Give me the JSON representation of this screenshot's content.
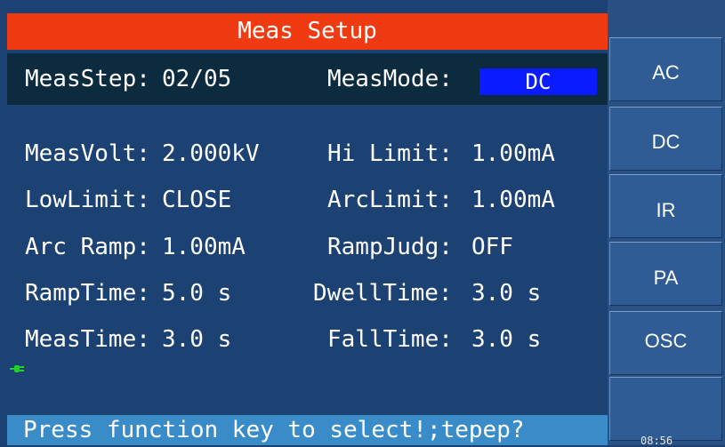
{
  "header": {
    "title": "Meas Setup"
  },
  "step_bar": {
    "meas_step_label": "MeasStep:",
    "meas_step_value": "02/05",
    "meas_mode_label": "MeasMode:",
    "meas_mode_value": "DC"
  },
  "params": {
    "meas_volt_label": "MeasVolt:",
    "meas_volt_value": "2.000kV",
    "hi_limit_label": "Hi Limit:",
    "hi_limit_value": "1.00mA",
    "low_limit_label": "LowLimit:",
    "low_limit_value": "CLOSE",
    "arc_limit_label": "ArcLimit:",
    "arc_limit_value": "1.00mA",
    "arc_ramp_label": "Arc Ramp:",
    "arc_ramp_value": "1.00mA",
    "ramp_judg_label": "RampJudg:",
    "ramp_judg_value": "OFF",
    "ramp_time_label": "RampTime:",
    "ramp_time_value": "5.0 s",
    "dwell_time_label": "DwellTime:",
    "dwell_time_value": "3.0 s",
    "meas_time_label": "MeasTime:",
    "meas_time_value": "3.0 s",
    "fall_time_label": "FallTime:",
    "fall_time_value": "3.0 s"
  },
  "help": {
    "message": "Press function key to select!;tepep?"
  },
  "softkeys": {
    "items": [
      {
        "label": "AC"
      },
      {
        "label": "DC"
      },
      {
        "label": "IR"
      },
      {
        "label": "PA"
      },
      {
        "label": "OSC"
      },
      {
        "label": ""
      }
    ]
  },
  "status": {
    "clock": "08:56"
  },
  "colors": {
    "title_bar": "#f03a12",
    "main_bg": "#1c4173",
    "step_bar_bg": "#0c2b3e",
    "mode_highlight": "#0a1cff",
    "help_bar_bg": "#3a8cc9",
    "softkey_bg": "#2f5c94",
    "indicator": "#1fd12a"
  },
  "icons": {
    "indicator": "plug-icon"
  }
}
